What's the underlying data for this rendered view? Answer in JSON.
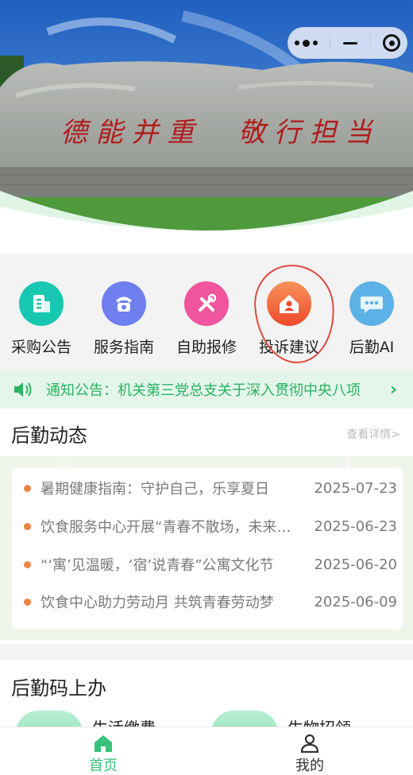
{
  "capsule": {
    "more_icon": "more-dots-icon",
    "minimize_icon": "minimize-icon",
    "close_icon": "close-target-icon"
  },
  "banner": {
    "inscription": "德能并重 敬行担当",
    "icon": "campus-stone-image"
  },
  "menu": [
    {
      "label": "采购公告",
      "icon": "building-icon",
      "color": "#17c7b1"
    },
    {
      "label": "服务指南",
      "icon": "phone-icon",
      "color": "#6f7ff0"
    },
    {
      "label": "自助报修",
      "icon": "tools-icon",
      "color": "#f0559d"
    },
    {
      "label": "投诉建议",
      "icon": "house-user-icon",
      "color": "#f5663c"
    },
    {
      "label": "后勤AI",
      "icon": "chat-bubble-icon",
      "color": "#5cb1e6"
    }
  ],
  "notice": {
    "text": "通知公告：机关第三党总支关于深入贯彻中央八项",
    "icon": "speaker-icon",
    "color": "#28b463"
  },
  "news": {
    "title": "后勤动态",
    "more": "查看详情>",
    "items": [
      {
        "title": "暑期健康指南：守护自己，乐享夏日",
        "date": "2025-07-23"
      },
      {
        "title": "饮食服务中心开展“青春不散场，未来可期”",
        "date": "2025-06-23"
      },
      {
        "title": "“‘寓’见温暖，‘宿’说青春”公寓文化节",
        "date": "2025-06-20"
      },
      {
        "title": "饮食中心助力劳动月 共筑青春劳动梦",
        "date": "2025-06-09"
      }
    ]
  },
  "codes": {
    "title": "后勤码上办",
    "items": [
      {
        "label": "生活缴费"
      },
      {
        "label": "生物招领"
      }
    ]
  },
  "tabbar": [
    {
      "label": "首页",
      "icon": "home-icon",
      "active": true,
      "color": "#3ac27a"
    },
    {
      "label": "我的",
      "icon": "user-icon",
      "active": false,
      "color": "#333333"
    }
  ]
}
